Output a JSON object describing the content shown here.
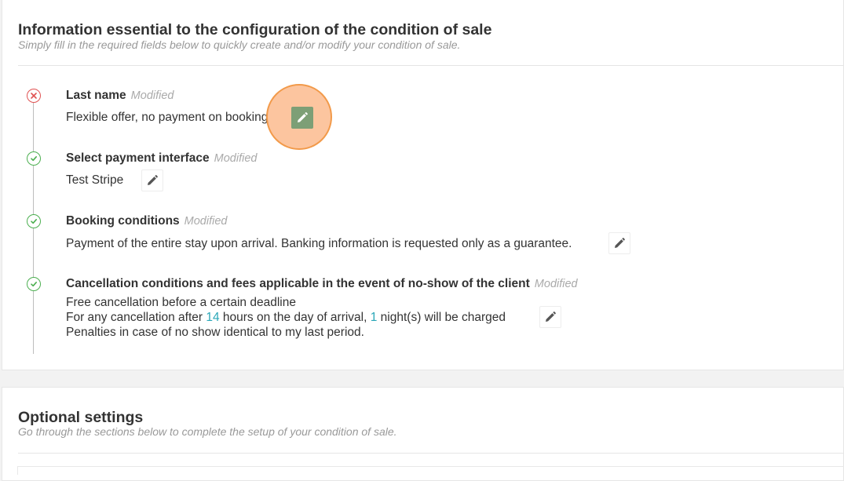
{
  "main_section": {
    "title": "Information essential to the configuration of the condition of sale",
    "subtitle": "Simply fill in the required fields below to quickly create and/or modify your condition of sale."
  },
  "steps": [
    {
      "status": "error",
      "label": "Last name",
      "modified": "Modified",
      "value": "Flexible offer, no payment on booking",
      "edit_icon": "pencil-icon"
    },
    {
      "status": "ok",
      "label": "Select payment interface",
      "modified": "Modified",
      "value": "Test Stripe",
      "edit_icon": "pencil-icon"
    },
    {
      "status": "ok",
      "label": "Booking conditions",
      "modified": "Modified",
      "value": "Payment of the entire stay upon arrival. Banking information is requested only as a guarantee.",
      "edit_icon": "pencil-icon"
    },
    {
      "status": "ok",
      "label": "Cancellation conditions and fees applicable in the event of no-show of the client",
      "modified": "Modified",
      "lines": {
        "line1": "Free cancellation before a certain deadline",
        "line2_prefix": "For any cancellation after ",
        "hours": "14",
        "line2_mid": " hours on the day of arrival, ",
        "nights": "1",
        "line2_suffix": " night(s) will be charged",
        "line3": "Penalties in case of no show identical to my last period."
      },
      "edit_icon": "pencil-icon"
    }
  ],
  "optional_section": {
    "title": "Optional settings",
    "subtitle": "Go through the sections below to complete the setup of your condition of sale."
  },
  "colors": {
    "error": "#e05252",
    "ok": "#4caf50",
    "accent_number": "#2aa7b8",
    "highlight": "#f29a4a",
    "active_edit": "#7d9f76"
  }
}
